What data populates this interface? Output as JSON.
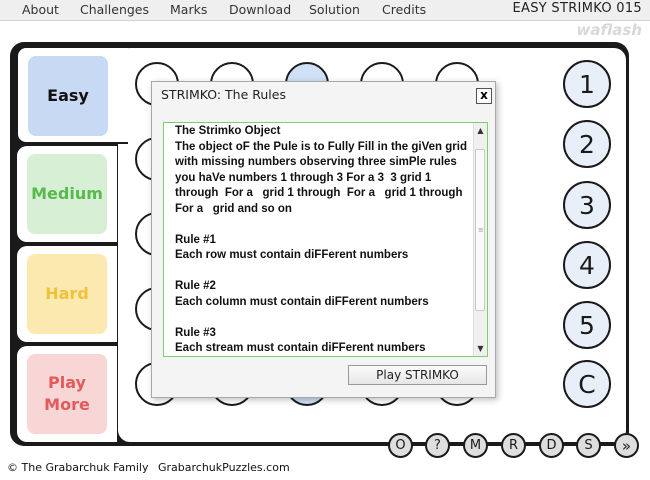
{
  "menu": {
    "items": [
      "About",
      "Challenges",
      "Marks",
      "Download",
      "Solution",
      "Credits"
    ]
  },
  "header": {
    "puzzle_title": "EASY STRIMKO 015",
    "brand": "waflash"
  },
  "tabs": [
    {
      "label": "Easy",
      "bg": "#c8d9f3",
      "color": "#111111"
    },
    {
      "label": "Medium",
      "bg": "#d7f0d5",
      "color": "#5ab84f"
    },
    {
      "label": "Hard",
      "bg": "#fbe9b0",
      "color": "#f0c23a"
    },
    {
      "label": "Play\nMore",
      "bg": "#f8d6d6",
      "color": "#e25a5a"
    }
  ],
  "number_buttons": [
    "1",
    "2",
    "3",
    "4",
    "5",
    "C"
  ],
  "bottom_buttons": [
    "O",
    "?",
    "M",
    "R",
    "D",
    "S",
    "»"
  ],
  "footer": {
    "copyright": "© The Grabarchuk Family",
    "site": "GrabarchukPuzzles.com"
  },
  "dialog": {
    "title": "STRIMKO: The Rules",
    "close_label": "x",
    "rules_text": "The Strimko Object\nThe object oF the Pule is to Fully Fill in the giVen grid with missing numbers observing three simPle rules you haVe numbers 1 through 3 For a 3  3 grid 1 through  For a   grid 1 through  For a   grid 1 through  For a   grid and so on\n\nRule #1\nEach row must contain diFFerent numbers\n\nRule #2\nEach column must contain diFFerent numbers\n\nRule #3\nEach stream must contain diFFerent numbers",
    "play_button": "Play STRIMKO"
  },
  "colors": {
    "board": "#1a1a1a",
    "accent_blue": "#cfe0f7",
    "textarea_border": "#7ccf6a"
  }
}
